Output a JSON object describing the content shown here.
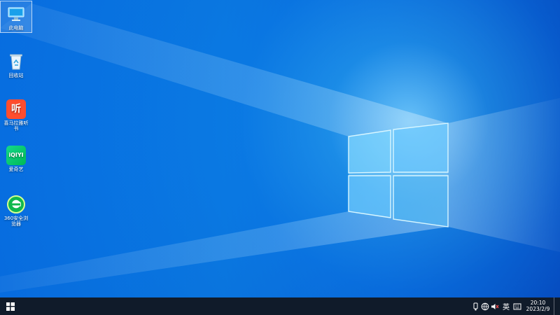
{
  "desktop": {
    "icons": [
      {
        "label": "此电脑",
        "icon": "pc-icon"
      },
      {
        "label": "回收站",
        "icon": "recycle-bin-icon"
      },
      {
        "label": "喜马拉雅听书",
        "icon": "ximalaya-app-icon"
      },
      {
        "label": "爱奇艺",
        "icon": "iqiyi-app-icon"
      },
      {
        "label": "360安全浏览器",
        "icon": "browser-360-icon"
      }
    ]
  },
  "taskbar": {
    "start_icon": "windows-logo-icon",
    "tray": {
      "language": "英",
      "icons": [
        "usb-icon",
        "network-icon",
        "volume-muted-icon",
        "input-method-icon"
      ]
    },
    "clock": {
      "time": "20:10",
      "date": "2023/2/9"
    }
  }
}
